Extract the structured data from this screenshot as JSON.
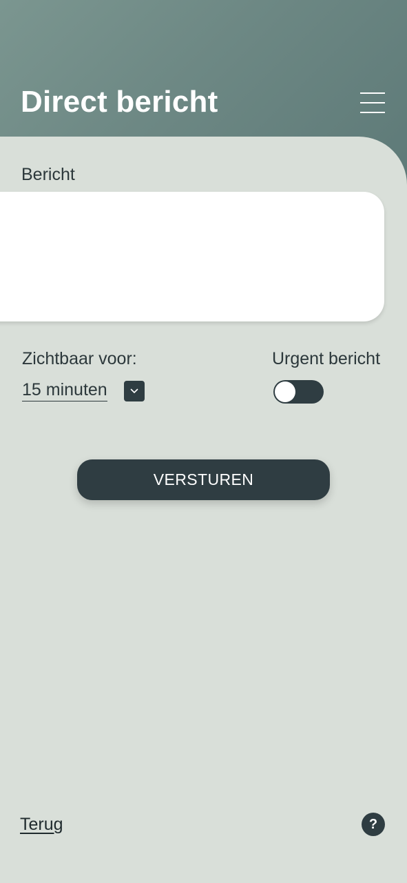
{
  "header": {
    "title": "Direct bericht",
    "menu_icon": "hamburger-menu-icon"
  },
  "form": {
    "message_label": "Bericht",
    "message_value": "",
    "visible_for_label": "Zichtbaar voor:",
    "visible_for_value": "15 minuten",
    "urgent_label": "Urgent bericht",
    "urgent_enabled": false,
    "send_label": "VERSTUREN"
  },
  "footer": {
    "back_label": "Terug",
    "help_label": "?"
  },
  "colors": {
    "header_gradient_start": "#7b9690",
    "header_gradient_end": "#5e7a78",
    "content_background": "#d9dfd9",
    "dark_accent": "#2f3d42",
    "text_dark": "#2c383b"
  }
}
